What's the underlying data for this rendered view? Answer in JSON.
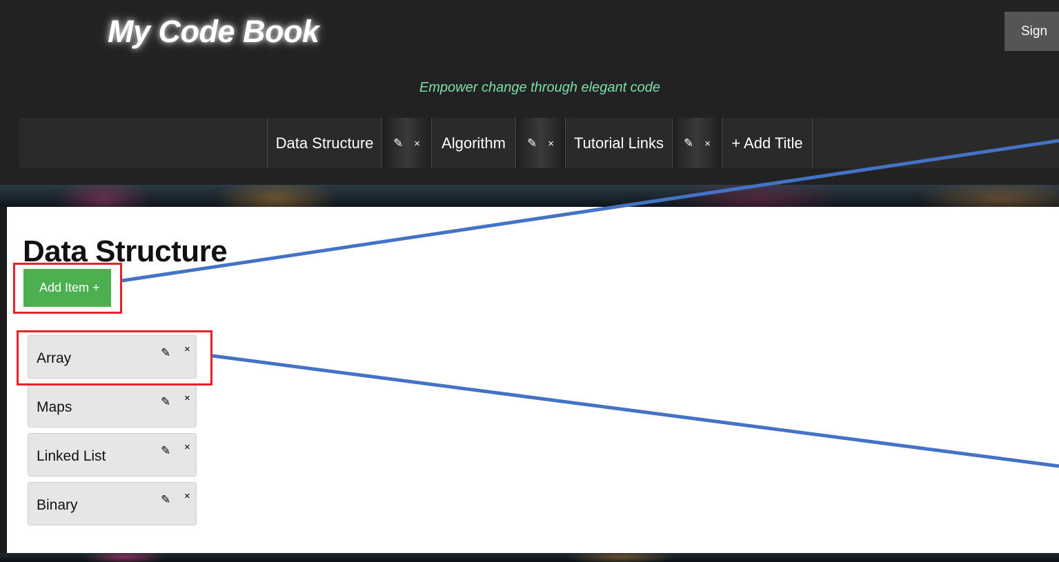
{
  "header": {
    "brand": "My Code Book",
    "sign_label": "Sign",
    "tagline": "Empower change through elegant code"
  },
  "nav": {
    "tabs": [
      {
        "label": "Data Structure",
        "edit_icon": "pencil-icon",
        "delete_icon": "close-icon"
      },
      {
        "label": "Algorithm",
        "edit_icon": "pencil-icon",
        "delete_icon": "close-icon"
      },
      {
        "label": "Tutorial Links",
        "edit_icon": "pencil-icon",
        "delete_icon": "close-icon"
      }
    ],
    "add_title_label": "+ Add Title"
  },
  "main": {
    "title": "Data Structure",
    "add_item_label": "Add Item +",
    "items": [
      {
        "label": "Array"
      },
      {
        "label": "Maps"
      },
      {
        "label": "Linked List"
      },
      {
        "label": "Binary"
      }
    ]
  },
  "glyphs": {
    "pencil": "✎",
    "close": "×"
  },
  "colors": {
    "header_bg": "#222222",
    "tagline": "#7be0a8",
    "add_item_bg": "#4caf50",
    "item_bg": "#e6e6e6",
    "highlight": "#e8202a",
    "arrow": "#4472c4"
  }
}
